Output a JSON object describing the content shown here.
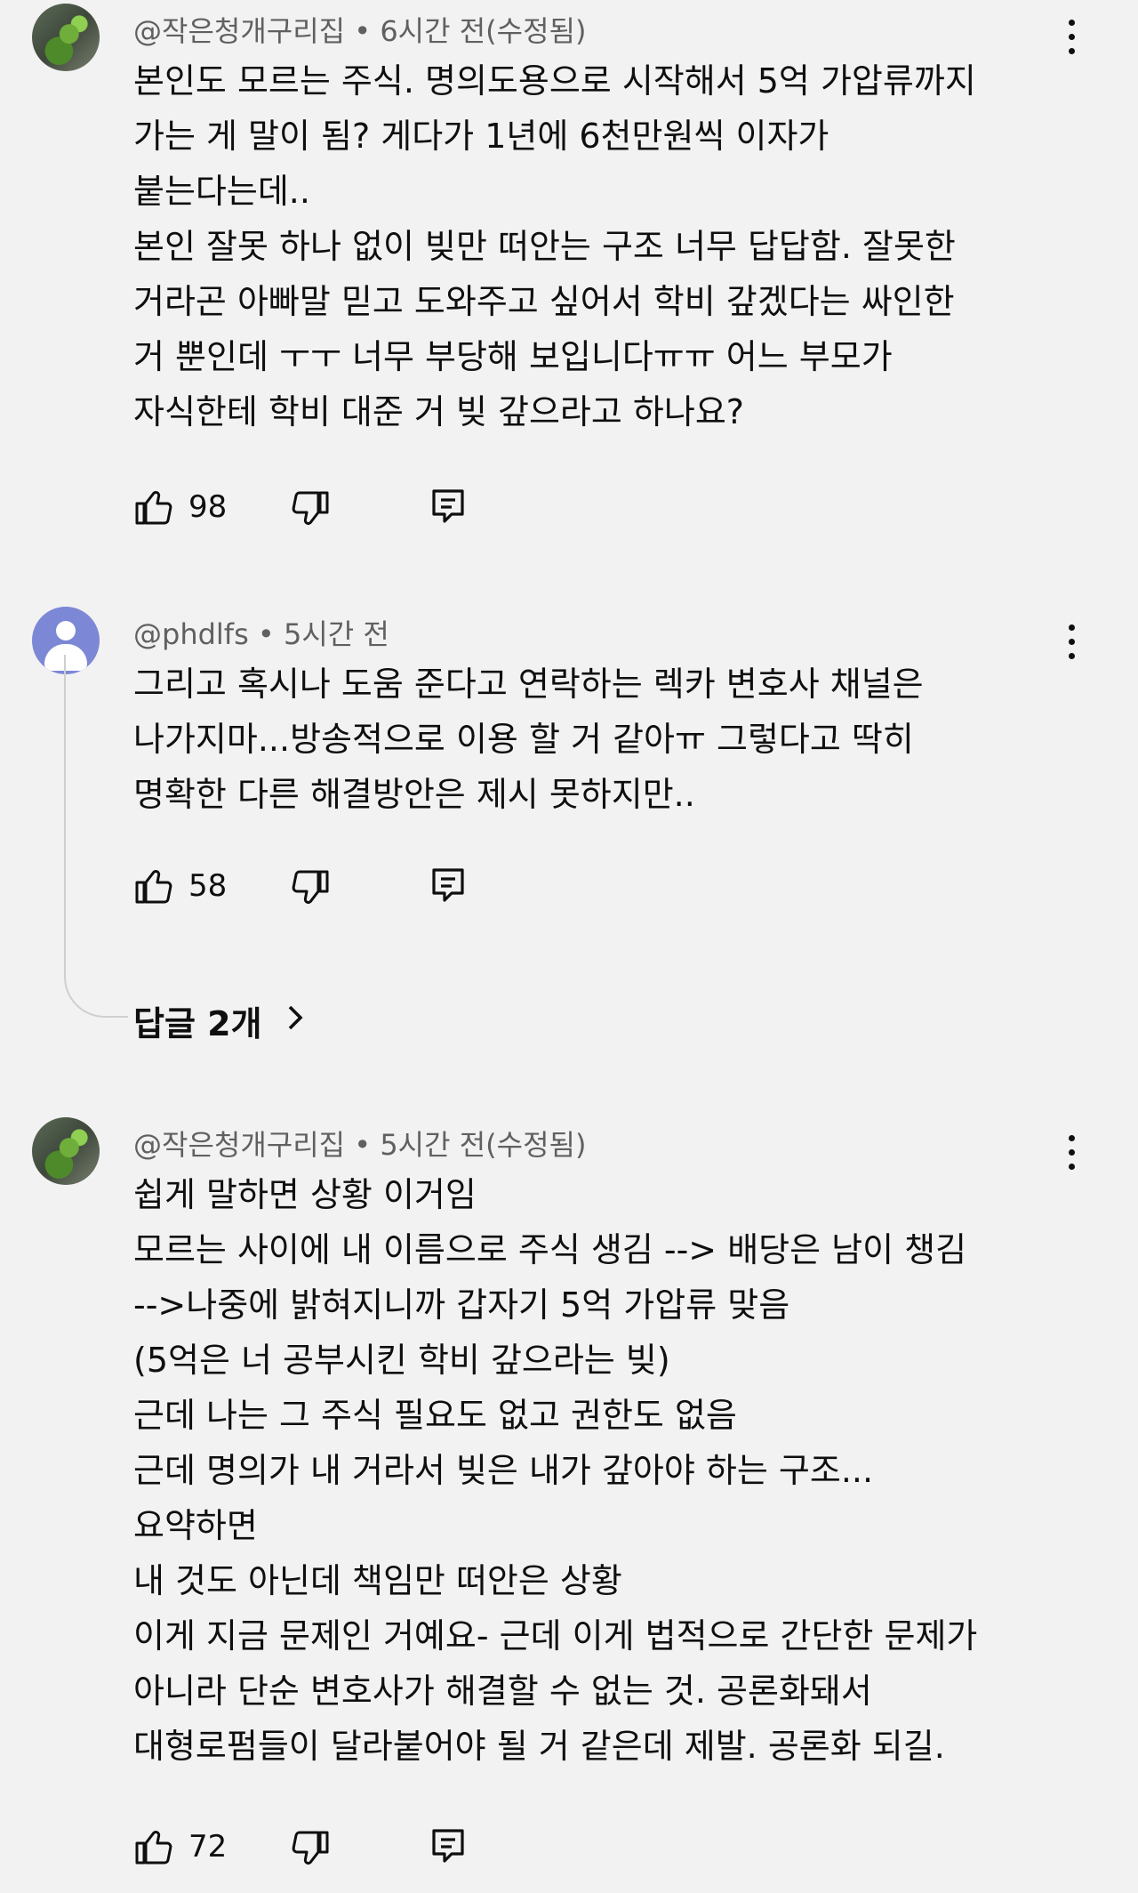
{
  "comments": [
    {
      "author": "@작은청개구리집",
      "dot": "•",
      "time": "6시간 전(수정됨)",
      "avatar_icon": "frog-avatar",
      "lines": [
        "본인도 모르는 주식. 명의도용으로 시작해서 5억 가압류까지",
        "가는 게 말이 됨? 게다가 1년에 6천만원씩 이자가",
        "붙는다는데..",
        "본인 잘못 하나 없이 빚만 떠안는 구조 너무 답답함. 잘못한",
        "거라곤 아빠말 믿고 도와주고 싶어서  학비 갚겠다는 싸인한",
        "거 뿐인데 ㅜㅜ 너무 부당해 보입니다ㅠㅠ 어느 부모가",
        "자식한테 학비 대준 거 빚 갚으라고 하나요?"
      ],
      "likes": "98"
    },
    {
      "author": "@phdlfs",
      "dot": "•",
      "time": "5시간 전",
      "avatar_icon": "default-user-avatar",
      "lines": [
        "그리고 혹시나 도움 준다고 연락하는 렉카 변호사 채널은",
        "나가지마...방송적으로 이용 할 거 같아ㅠ 그렇다고 딱히",
        "명확한 다른 해결방안은 제시 못하지만.."
      ],
      "likes": "58",
      "replies_label": "답글 2개"
    },
    {
      "author": "@작은청개구리집",
      "dot": "•",
      "time": "5시간 전(수정됨)",
      "avatar_icon": "frog-avatar",
      "lines": [
        "쉽게 말하면 상황 이거임",
        "모르는 사이에 내 이름으로 주식 생김 --> 배당은 남이 챙김",
        "-->나중에 밝혀지니까 갑자기 5억 가압류 맞음",
        "(5억은 너 공부시킨 학비 갚으라는 빚)",
        "근데 나는 그 주식 필요도 없고 권한도 없음",
        "근데 명의가 내 거라서 빚은 내가 갚아야 하는 구조...",
        "요약하면",
        "내 것도 아닌데 책임만 떠안은 상황",
        "이게 지금 문제인 거예요- 근데 이게 법적으로 간단한 문제가",
        "아니라 단순 변호사가 해결할 수 없는 것.  공론화돼서",
        "대형로펌들이 달라붙어야 될  거 같은데 제발. 공론화 되길."
      ],
      "likes": "72"
    }
  ]
}
